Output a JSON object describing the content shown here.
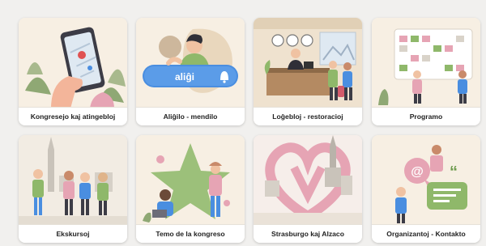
{
  "tiles": [
    {
      "label": "Kongresejo kaj atingebloj",
      "icon": "phone-map-icon"
    },
    {
      "label": "Aliĝilo - mendilo",
      "icon": "signup-button-icon",
      "button_text": "aliĝi"
    },
    {
      "label": "Loĝebloj - restoracioj",
      "icon": "hotel-reception-icon"
    },
    {
      "label": "Programo",
      "icon": "calendar-board-icon"
    },
    {
      "label": "Ekskursoj",
      "icon": "tour-group-icon"
    },
    {
      "label": "Temo de la kongreso",
      "icon": "star-icon"
    },
    {
      "label": "Strasburgo kaj Alzaco",
      "icon": "heart-city-icon"
    },
    {
      "label": "Organizantoj - Kontakto",
      "icon": "contact-chat-icon"
    }
  ],
  "colors": {
    "background": "#f1f0ee",
    "card": "#fbf7f0",
    "accent_blue": "#4a8ee0",
    "accent_pink": "#e6a4b4",
    "accent_green": "#8fb86a"
  }
}
